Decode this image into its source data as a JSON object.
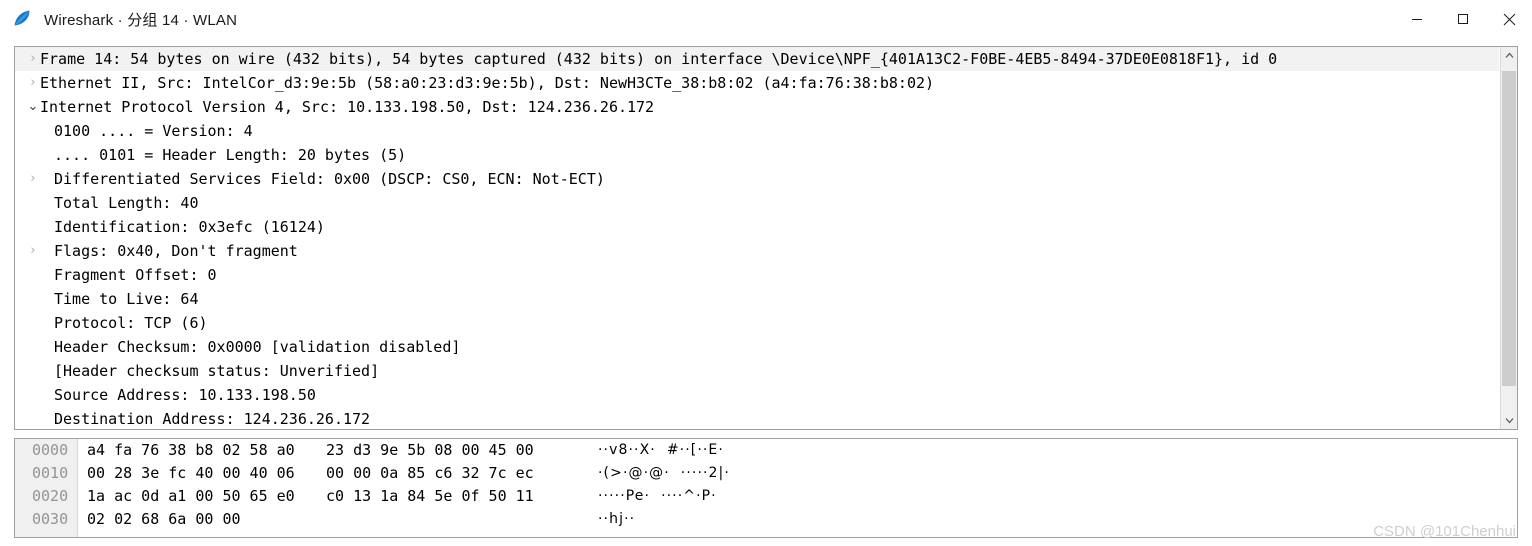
{
  "window": {
    "title": "Wireshark · 分组 14 · WLAN",
    "logo_icon": "wireshark-fin-icon",
    "controls": [
      {
        "name": "minimize",
        "icon": "minimize-icon"
      },
      {
        "name": "maximize",
        "icon": "maximize-icon"
      },
      {
        "name": "close",
        "icon": "close-icon"
      }
    ]
  },
  "detail_pane": {
    "rows": [
      {
        "twisty": "collapsed",
        "level": 0,
        "highlight": true,
        "text": "Frame 14: 54 bytes on wire (432 bits), 54 bytes captured (432 bits) on interface \\Device\\NPF_{401A13C2-F0BE-4EB5-8494-37DE0E0818F1}, id 0"
      },
      {
        "twisty": "collapsed",
        "level": 0,
        "highlight": false,
        "text": "Ethernet II, Src: IntelCor_d3:9e:5b (58:a0:23:d3:9e:5b), Dst: NewH3CTe_38:b8:02 (a4:fa:76:38:b8:02)"
      },
      {
        "twisty": "expanded",
        "level": 0,
        "highlight": false,
        "text": "Internet Protocol Version 4, Src: 10.133.198.50, Dst: 124.236.26.172"
      },
      {
        "twisty": "blank",
        "level": 1,
        "highlight": false,
        "text": "0100 .... = Version: 4"
      },
      {
        "twisty": "blank",
        "level": 1,
        "highlight": false,
        "text": ".... 0101 = Header Length: 20 bytes (5)"
      },
      {
        "twisty": "collapsed",
        "level": 1,
        "highlight": false,
        "text": "Differentiated Services Field: 0x00 (DSCP: CS0, ECN: Not-ECT)"
      },
      {
        "twisty": "blank",
        "level": 1,
        "highlight": false,
        "text": "Total Length: 40"
      },
      {
        "twisty": "blank",
        "level": 1,
        "highlight": false,
        "text": "Identification: 0x3efc (16124)"
      },
      {
        "twisty": "collapsed",
        "level": 1,
        "highlight": false,
        "text": "Flags: 0x40, Don't fragment"
      },
      {
        "twisty": "blank",
        "level": 1,
        "highlight": false,
        "text": "Fragment Offset: 0"
      },
      {
        "twisty": "blank",
        "level": 1,
        "highlight": false,
        "text": "Time to Live: 64"
      },
      {
        "twisty": "blank",
        "level": 1,
        "highlight": false,
        "text": "Protocol: TCP (6)"
      },
      {
        "twisty": "blank",
        "level": 1,
        "highlight": false,
        "text": "Header Checksum: 0x0000 [validation disabled]"
      },
      {
        "twisty": "blank",
        "level": 1,
        "highlight": false,
        "text": "[Header checksum status: Unverified]"
      },
      {
        "twisty": "blank",
        "level": 1,
        "highlight": false,
        "text": "Source Address: 10.133.198.50"
      },
      {
        "twisty": "blank",
        "level": 1,
        "highlight": false,
        "text": "Destination Address: 124.236.26.172"
      }
    ],
    "scrollbar": {
      "up_icon": "chevron-up-icon",
      "down_icon": "chevron-down-icon"
    }
  },
  "hex_pane": {
    "rows": [
      {
        "offset": "0000",
        "bytes1": "a4 fa 76 38 b8 02 58 a0",
        "bytes2": "23 d3 9e 5b 08 00 45 00",
        "ascii1": "··v8··X·",
        "ascii2": "#··[··E·"
      },
      {
        "offset": "0010",
        "bytes1": "00 28 3e fc 40 00 40 06",
        "bytes2": "00 00 0a 85 c6 32 7c ec",
        "ascii1": "·(>·@·@·",
        "ascii2": "·····2|·"
      },
      {
        "offset": "0020",
        "bytes1": "1a ac 0d a1 00 50 65 e0",
        "bytes2": "c0 13 1a 84 5e 0f 50 11",
        "ascii1": "·····Pe·",
        "ascii2": "····^·P·"
      },
      {
        "offset": "0030",
        "bytes1": "02 02 68 6a 00 00",
        "bytes2": "",
        "ascii1": "··hj··",
        "ascii2": ""
      }
    ]
  },
  "watermark": {
    "text": "CSDN @101Chenhui"
  },
  "colors": {
    "accent": "#1679c8",
    "pane_border": "#a0a0a0",
    "offset_text": "#949494",
    "scroll_thumb": "#cdcdcd",
    "row_highlight": "#f2f2f2",
    "watermark": "#cfcfcf"
  }
}
